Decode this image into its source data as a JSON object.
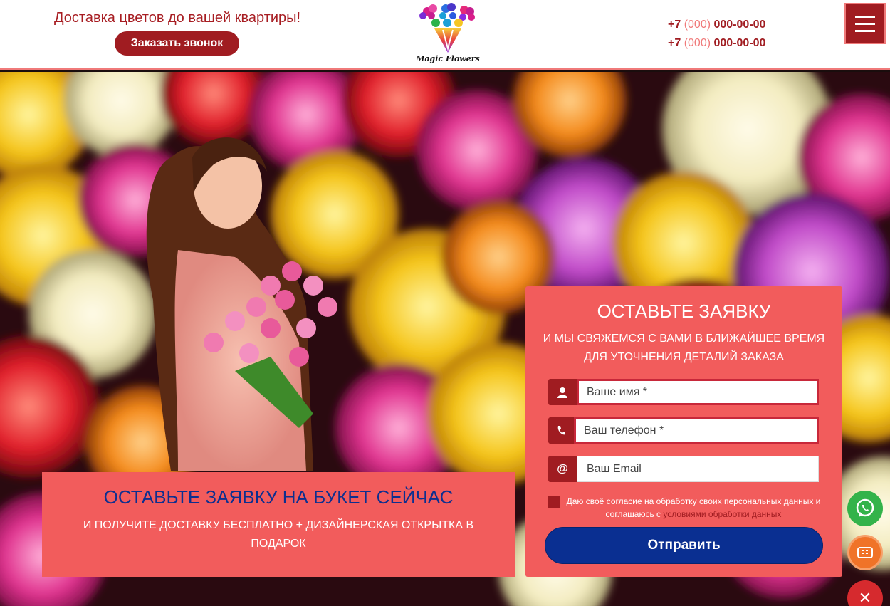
{
  "header": {
    "tagline": "Доставка цветов до вашей квартиры!",
    "callback_label": "Заказать звонок",
    "logo_text": "Magic Flowers",
    "phones": [
      {
        "prefix": "+7 ",
        "code": "(000)",
        "number": " 000-00-00"
      },
      {
        "prefix": "+7 ",
        "code": "(000)",
        "number": " 000-00-00"
      }
    ],
    "menu_icon": "hamburger-icon"
  },
  "promo": {
    "title": "ОСТАВЬТЕ ЗАЯВКУ НА БУКЕТ СЕЙЧАС",
    "subtitle": "И ПОЛУЧИТЕ ДОСТАВКУ БЕСПЛАТНО + ДИЗАЙНЕРСКАЯ ОТКРЫТКА В ПОДАРОК"
  },
  "form": {
    "title": "ОСТАВЬТЕ ЗАЯВКУ",
    "subtitle": "И МЫ СВЯЖЕМСЯ С ВАМИ В БЛИЖАЙШЕЕ ВРЕМЯ ДЛЯ УТОЧНЕНИЯ ДЕТАЛИЙ ЗАКАЗА",
    "name_placeholder": "Ваше имя *",
    "phone_placeholder": "Ваш телефон *",
    "email_placeholder": "Ваш Email",
    "email_icon_glyph": "@",
    "consent_text": "Даю своё согласие на обработку своих персональных данных и соглашаюсь с ",
    "consent_link": "условиями обработки данных",
    "submit_label": "Отправить"
  },
  "floating": {
    "whatsapp_icon": "whatsapp-icon",
    "call_icon": "phone-icon",
    "close_glyph": "✕"
  },
  "colors": {
    "brand_red": "#a01c21",
    "coral": "#f25c5c",
    "navy": "#0a2f91",
    "whatsapp_green": "#33b34a",
    "call_orange": "#f07328"
  }
}
